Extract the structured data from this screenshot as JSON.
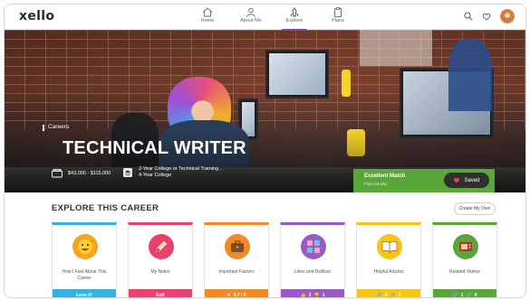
{
  "app": {
    "logo": "xello"
  },
  "nav": [
    {
      "label": "Home",
      "icon": "home-icon",
      "active": false
    },
    {
      "label": "About Me",
      "icon": "person-icon",
      "active": false
    },
    {
      "label": "Explore",
      "icon": "explore-icon",
      "active": true
    },
    {
      "label": "Plans",
      "icon": "clipboard-icon",
      "active": false
    }
  ],
  "hero": {
    "tag": "Careers",
    "title": "TECHNICAL WRITER",
    "salary": "$43,000 - $115,000",
    "education_line1": "2-Year College or Technical Training ,",
    "education_line2": "4-Year College",
    "match_title": "Excellent Match",
    "match_sub": "Find out why",
    "saved_label": "Saved"
  },
  "explore": {
    "title": "EXPLORE THIS CAREER",
    "create_label": "Create My Own",
    "cards": [
      {
        "title": "How I Feel About This Career",
        "footer": "Love it!",
        "color": "#3ab0e0",
        "icon_bg": "#f7a51c",
        "icon": "smiley-icon"
      },
      {
        "title": "My Notes",
        "footer": "Edit",
        "color": "#e8416e",
        "icon_bg": "#e8416e",
        "icon": "pencil-icon"
      },
      {
        "title": "Important Factors",
        "footer": "4.7 / 5",
        "color": "#f08a24",
        "icon_bg": "#f08a24",
        "icon": "briefcase-icon"
      },
      {
        "title": "Likes and Dislikes",
        "footer_likes": "2",
        "footer_dislikes": "1",
        "color": "#9b59c6",
        "icon_bg": "#9b59c6",
        "icon": "likes-icon"
      },
      {
        "title": "Helpful Articles",
        "footer_a": "0",
        "footer_b": "1",
        "color": "#f5c518",
        "icon_bg": "#f5c518",
        "icon": "book-icon"
      },
      {
        "title": "Related Videos",
        "footer_a": "1",
        "footer_b": "0",
        "color": "#5aa63a",
        "icon_bg": "#5aa63a",
        "icon": "video-icon"
      }
    ]
  }
}
